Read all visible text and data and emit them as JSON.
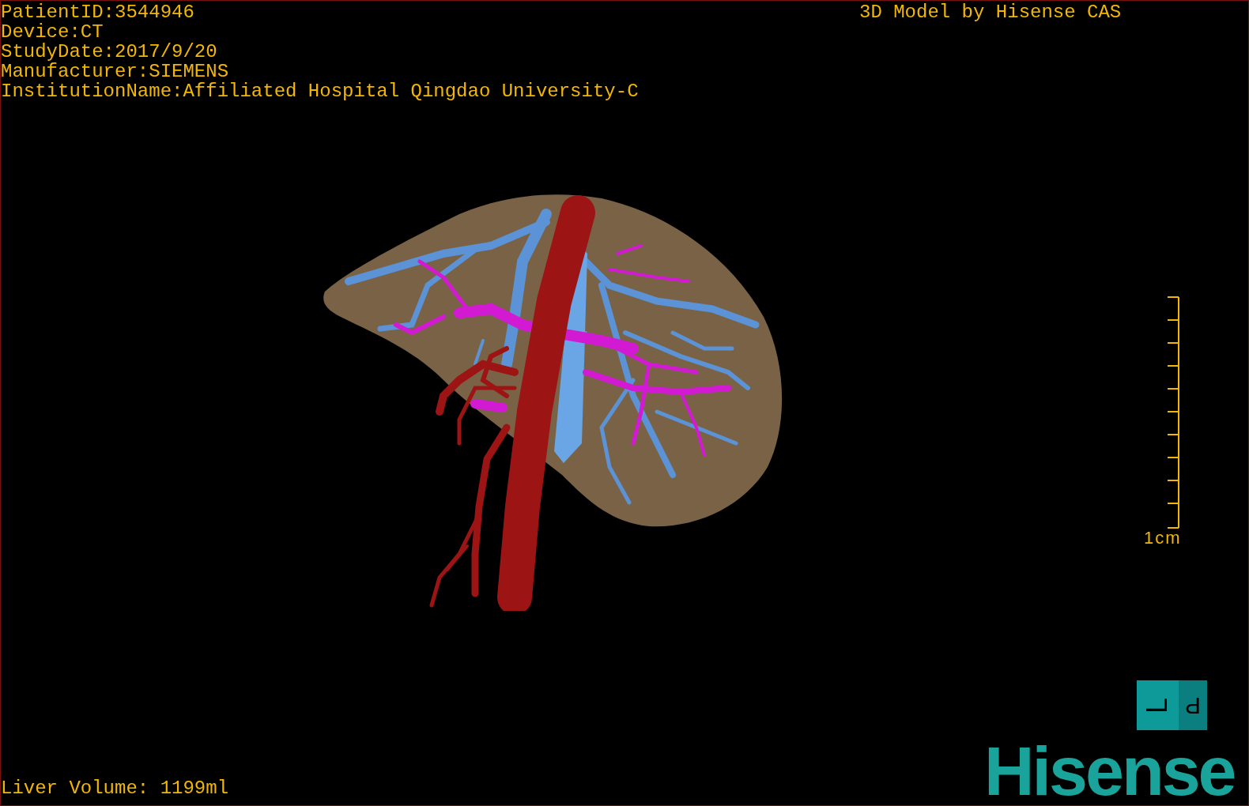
{
  "info_lines": [
    "PatientID:3544946",
    "Device:CT",
    "StudyDate:2017/9/20",
    "Manufacturer:SIEMENS",
    "InstitutionName:Affiliated Hospital Qingdao University-C"
  ],
  "title": "3D Model by Hisense CAS",
  "scale_bar": {
    "label": "1cm"
  },
  "orientation_cube": {
    "left_face": "L",
    "right_face": "P"
  },
  "volume": "Liver Volume: 1199ml",
  "logo": "Hisense"
}
